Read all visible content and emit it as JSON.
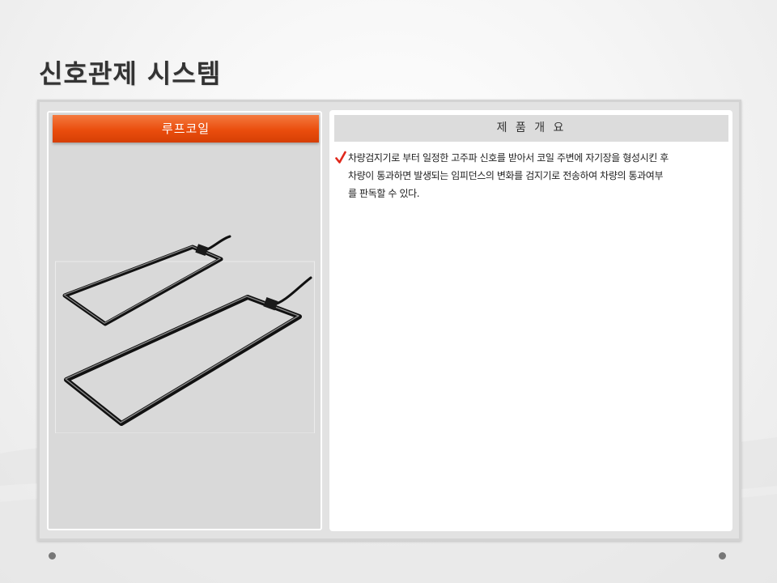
{
  "slide": {
    "title": "신호관제 시스템"
  },
  "left_panel": {
    "header": "루프코일",
    "image": {
      "subject": "loop coil",
      "icon": "loop-coil-illustration"
    }
  },
  "right_panel": {
    "header": "제 품 개 요",
    "bullet_icon": "check-mark-icon",
    "bullet_color": "#e0281b",
    "description_lines": [
      "차량검지기로 부터 일정한 고주파 신호를 받아서 코일 주변에 자기장을 형성시킨 후",
      "차량이 통과하면 발생되는 임피던스의 변화를 검지기로 전송하여 차량의 통과여부",
      "를 판독할 수 있다."
    ]
  },
  "colors": {
    "accent_orange": "#ea4d0d",
    "title_text": "#333333",
    "header_gray": "#dcdcdc"
  }
}
